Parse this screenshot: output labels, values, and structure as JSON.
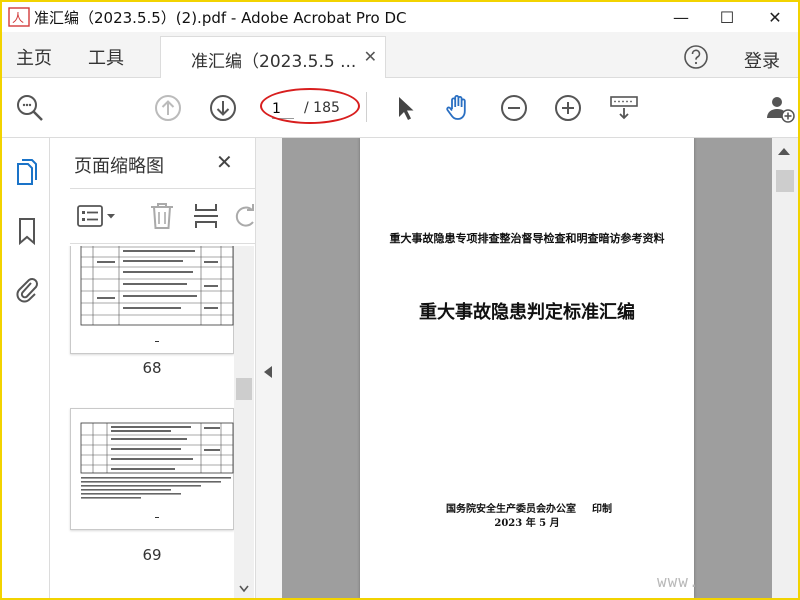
{
  "window": {
    "title": "准汇编（2023.5.5）(2).pdf - Adobe Acrobat Pro DC",
    "minimize_glyph": "—",
    "maximize_glyph": "☐",
    "close_glyph": "✕"
  },
  "tabs": {
    "home_label": "主页",
    "tools_label": "工具",
    "document_label": "准汇编（2023.5.5 ...",
    "document_close_glyph": "✕",
    "login_label": "登录"
  },
  "toolbar": {
    "current_page": "1",
    "total_pages": "/ 185",
    "icons": [
      "search-zoom-icon",
      "prev-page-icon",
      "next-page-icon",
      "select-cursor-icon",
      "hand-tool-icon",
      "zoom-out-icon",
      "zoom-in-icon",
      "keyboard-scroll-icon",
      "add-user-icon"
    ]
  },
  "thumbnails": {
    "panel_title": "页面缩略图",
    "close_glyph": "✕",
    "items": [
      {
        "page_label": "68"
      },
      {
        "page_label": "69"
      }
    ]
  },
  "document": {
    "subtitle": "重大事故隐患专项排查整治督导检查和明查暗访参考资料",
    "title": "重大事故隐患判定标准汇编",
    "issuer": "国务院安全生产委员会办公室",
    "issuer_action": "印制",
    "date": "2023 年 5 月"
  },
  "watermark": "www."
}
